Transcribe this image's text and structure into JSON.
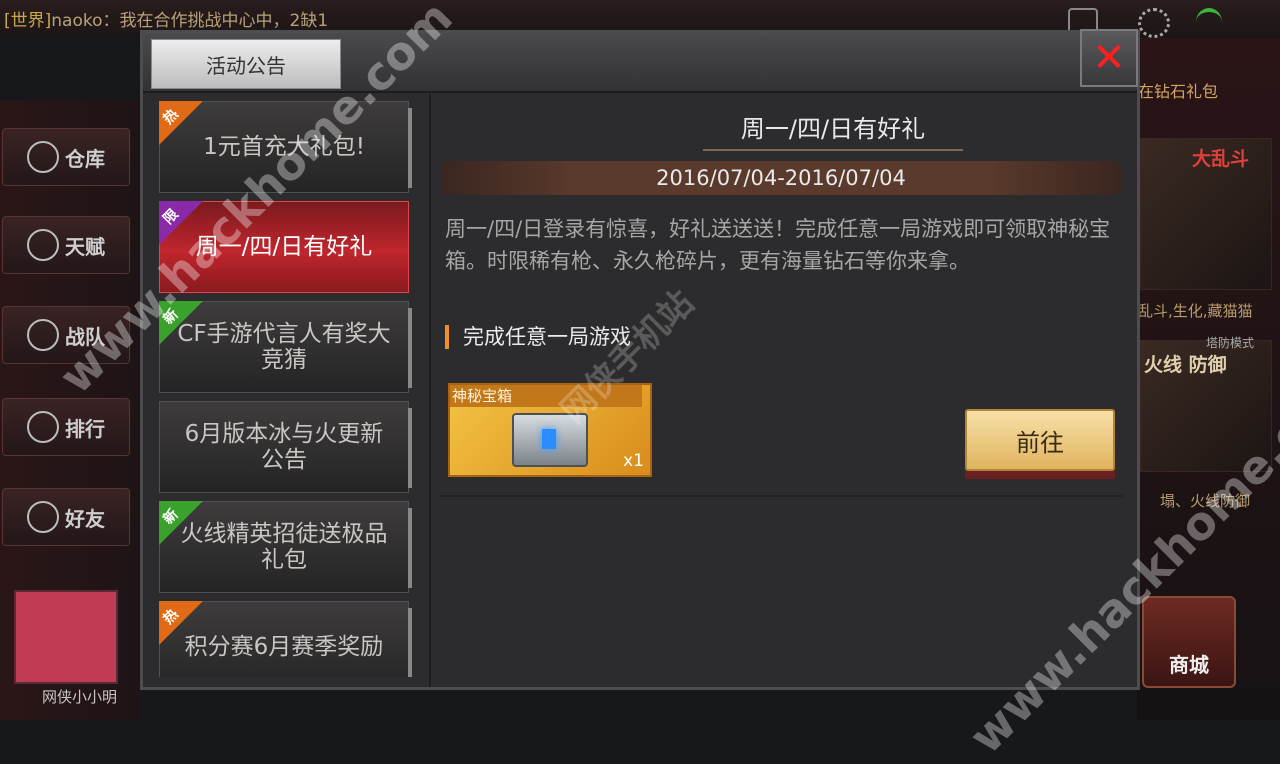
{
  "background": {
    "chat_channel": "[世界]",
    "chat_text": "naoko：我在合作挑战中心中，2缺1",
    "rail": [
      "仓库",
      "天赋",
      "战队",
      "排行",
      "好友"
    ],
    "right_banner_1": "在钻石礼包",
    "right_title": "大乱斗",
    "right_text_1": "乱斗,生化,藏猫猫",
    "right_title_2": "火线 防御",
    "right_mode": "塔防模式",
    "right_text_2": "塌、火线防御",
    "shop": "商城",
    "player_name": "网侠小小明"
  },
  "dialog": {
    "title": "活动公告",
    "close_icon": "close-x-icon",
    "list": [
      {
        "tag": "热",
        "label": "1元首充大礼包!"
      },
      {
        "tag": "限",
        "label": "周一/四/日有好礼"
      },
      {
        "tag": "新",
        "label": "CF手游代言人有奖大竞猜"
      },
      {
        "tag": "",
        "label": "6月版本冰与火更新公告"
      },
      {
        "tag": "新",
        "label": "火线精英招徒送极品礼包"
      },
      {
        "tag": "热",
        "label": "积分赛6月赛季奖励"
      }
    ],
    "selected_index": 1,
    "detail": {
      "title": "周一/四/日有好礼",
      "date_range": "2016/07/04-2016/07/04",
      "description": "周一/四/日登录有惊喜，好礼送送送！完成任意一局游戏即可领取神秘宝箱。时限稀有枪、永久枪碎片，更有海量钻石等你来拿。",
      "task": "完成任意一局游戏",
      "reward_name": "神秘宝箱",
      "reward_qty": "x1",
      "go_label": "前往"
    }
  },
  "watermarks": [
    "www.hackhome.com",
    "网侠手机站",
    "www.hackhome.com"
  ]
}
